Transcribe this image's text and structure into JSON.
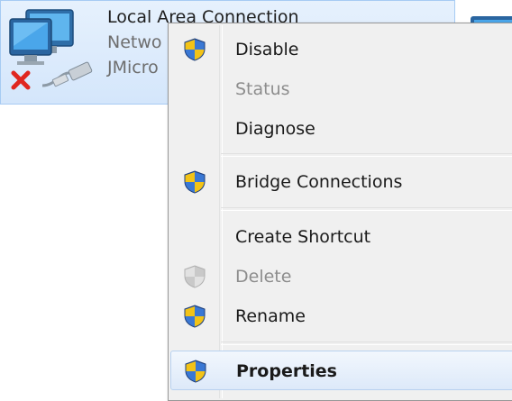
{
  "connection": {
    "name": "Local Area Connection",
    "line2": "Netwo",
    "line3": "JMicro"
  },
  "menu": {
    "items": [
      {
        "label": "Disable",
        "icon": "uac-shield-icon",
        "state": "enabled"
      },
      {
        "label": "Status",
        "icon": "",
        "state": "disabled"
      },
      {
        "label": "Diagnose",
        "icon": "",
        "state": "enabled"
      },
      {
        "label": "Bridge Connections",
        "icon": "uac-shield-icon",
        "state": "enabled"
      },
      {
        "label": "Create Shortcut",
        "icon": "",
        "state": "enabled"
      },
      {
        "label": "Delete",
        "icon": "uac-shield-icon",
        "state": "disabled"
      },
      {
        "label": "Rename",
        "icon": "uac-shield-icon",
        "state": "enabled"
      },
      {
        "label": "Properties",
        "icon": "uac-shield-icon",
        "state": "default-highlighted"
      }
    ]
  },
  "colors": {
    "selection_bg": "#d9e8fb",
    "menu_bg": "#f0f0f0",
    "disabled_text": "#8d8d8d",
    "error_x": "#e0261f"
  }
}
